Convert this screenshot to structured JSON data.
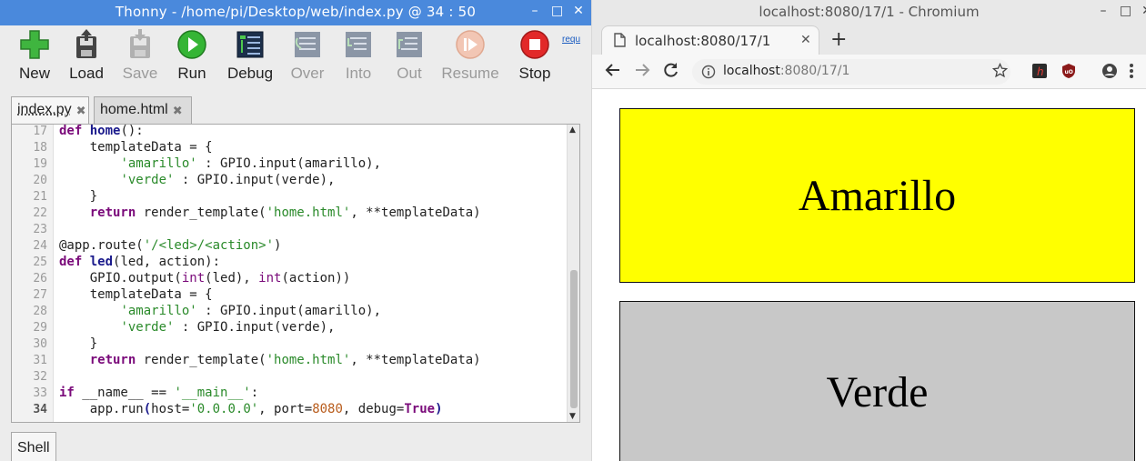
{
  "thonny": {
    "title": "Thonny  -  /home/pi/Desktop/web/index.py  @  34 : 50",
    "window_buttons": [
      "–",
      "□",
      "✕"
    ],
    "toolbar": [
      {
        "label": "New",
        "icon": "new-file-icon",
        "enabled": true
      },
      {
        "label": "Load",
        "icon": "load-icon",
        "enabled": true
      },
      {
        "label": "Save",
        "icon": "save-icon",
        "enabled": false
      },
      {
        "label": "Run",
        "icon": "run-icon",
        "enabled": true
      },
      {
        "label": "Debug",
        "icon": "debug-icon",
        "enabled": true
      },
      {
        "label": "Over",
        "icon": "step-over-icon",
        "enabled": false
      },
      {
        "label": "Into",
        "icon": "step-into-icon",
        "enabled": false
      },
      {
        "label": "Out",
        "icon": "step-out-icon",
        "enabled": false
      },
      {
        "label": "Resume",
        "icon": "resume-icon",
        "enabled": false
      },
      {
        "label": "Stop",
        "icon": "stop-icon",
        "enabled": true
      }
    ],
    "support_link": "requ",
    "tabs": [
      "index.py",
      "home.html"
    ],
    "active_tab": "index.py",
    "line_numbers": [
      "17",
      "18",
      "19",
      "20",
      "21",
      "22",
      "23",
      "24",
      "25",
      "26",
      "27",
      "28",
      "29",
      "30",
      "31",
      "32",
      "33",
      "34"
    ],
    "current_line": "34",
    "shell_tab": "Shell"
  },
  "chromium": {
    "title": "localhost:8080/17/1 - Chromium",
    "window_buttons": [
      "–",
      "□",
      "✕"
    ],
    "tab_title": "localhost:8080/17/1",
    "new_tab": "+",
    "url_host": "localhost",
    "url_rest": ":8080/17/1",
    "buttons": [
      {
        "label": "Amarillo",
        "color": "#ffff00"
      },
      {
        "label": "Verde",
        "color": "#c8c8c8"
      }
    ]
  }
}
